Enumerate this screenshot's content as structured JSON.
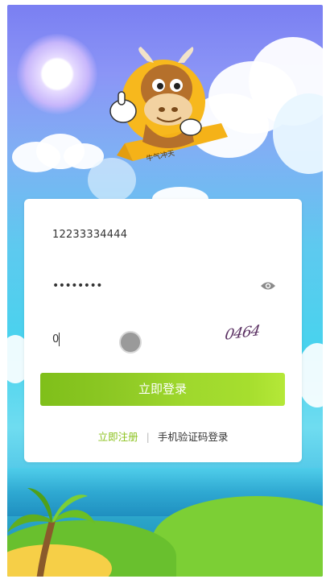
{
  "login": {
    "phone_value": "12233334444",
    "password_masked": "••••••••",
    "captcha_input_value": "0",
    "captcha_code": "0464",
    "submit_label": "立即登录"
  },
  "footer_links": {
    "register": "立即注册",
    "separator": "|",
    "sms_login": "手机验证码登录"
  },
  "mascot": {
    "ribbon_text": "牛气冲天"
  },
  "colors": {
    "accent": "#8ac11c",
    "button_start": "#7fbf1a",
    "button_end": "#b5e838",
    "captcha": "#5b3163"
  }
}
